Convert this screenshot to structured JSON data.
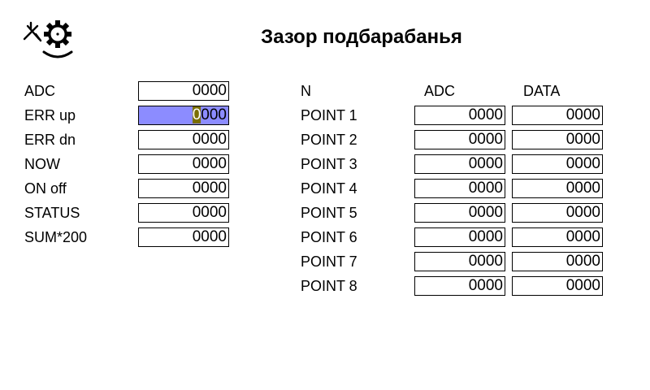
{
  "header": {
    "title": "Зазор подбарабанья",
    "logo_icon": "thresher-gear-icon"
  },
  "left_panel": {
    "rows": [
      {
        "label": "ADC",
        "value": "0000"
      },
      {
        "label": "ERR up",
        "value": "0000",
        "selected": true,
        "cursor_char": "0",
        "rest": "000"
      },
      {
        "label": "ERR dn",
        "value": "0000"
      },
      {
        "label": "NOW",
        "value": "0000"
      },
      {
        "label": "ON off",
        "value": "0000"
      },
      {
        "label": "STATUS",
        "value": "0000"
      },
      {
        "label": "SUM*200",
        "value": "0000"
      }
    ]
  },
  "points_table": {
    "headers": {
      "n": "N",
      "adc": "ADC",
      "data": "DATA"
    },
    "rows": [
      {
        "label": "POINT 1",
        "adc": "0000",
        "data": "0000"
      },
      {
        "label": "POINT 2",
        "adc": "0000",
        "data": "0000"
      },
      {
        "label": "POINT 3",
        "adc": "0000",
        "data": "0000"
      },
      {
        "label": "POINT 4",
        "adc": "0000",
        "data": "0000"
      },
      {
        "label": "POINT 5",
        "adc": "0000",
        "data": "0000"
      },
      {
        "label": "POINT 6",
        "adc": "0000",
        "data": "0000"
      },
      {
        "label": "POINT 7",
        "adc": "0000",
        "data": "0000"
      },
      {
        "label": "POINT 8",
        "adc": "0000",
        "data": "0000"
      }
    ]
  },
  "colors": {
    "selected_field_bg": "#8c8cff",
    "cursor_bg": "#7a6e00"
  }
}
